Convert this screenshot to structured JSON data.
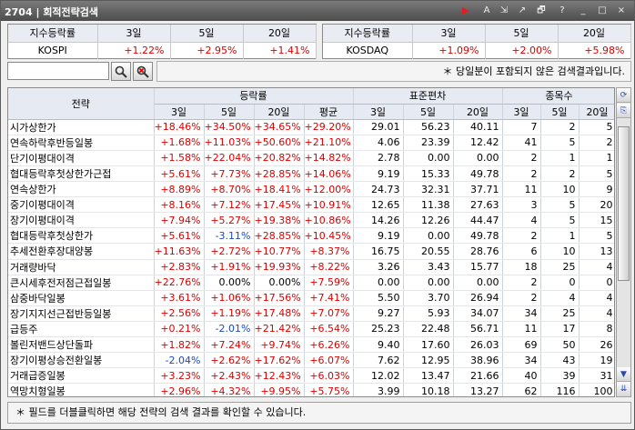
{
  "window": {
    "code": "2704",
    "title": "회적전략검색"
  },
  "title_controls": [
    "▶",
    "A",
    "⇲",
    "↗",
    "🗗",
    "?",
    "_",
    "□",
    "×"
  ],
  "index_boxes": [
    {
      "header": [
        "지수등락률",
        "3일",
        "5일",
        "20일"
      ],
      "values": [
        "KOSPI",
        "+1.22%",
        "+2.95%",
        "+1.41%"
      ]
    },
    {
      "header": [
        "지수등락률",
        "3일",
        "5일",
        "20일"
      ],
      "values": [
        "KOSDAQ",
        "+1.09%",
        "+2.00%",
        "+5.98%"
      ]
    }
  ],
  "search": {
    "value": "",
    "note": "＊ 당일분이 포함되지 않은 검색결과입니다."
  },
  "grid": {
    "col_strategy": "전략",
    "group_headers": [
      "등락률",
      "표준편차",
      "종목수"
    ],
    "sub_headers": [
      "3일",
      "5일",
      "20일",
      "평균",
      "3일",
      "5일",
      "20일",
      "3일",
      "5일",
      "20일"
    ],
    "rows": [
      [
        "시가상한가",
        "+18.46%",
        "+34.50%",
        "+34.65%",
        "+29.20%",
        "29.01",
        "56.23",
        "40.11",
        "7",
        "2",
        "5"
      ],
      [
        "연속하락후반등일봉",
        "+1.68%",
        "+11.03%",
        "+50.60%",
        "+21.10%",
        "4.06",
        "23.39",
        "12.42",
        "41",
        "5",
        "2"
      ],
      [
        "단기이평대이격",
        "+1.58%",
        "+22.04%",
        "+20.82%",
        "+14.82%",
        "2.78",
        "0.00",
        "0.00",
        "2",
        "1",
        "1"
      ],
      [
        "협대등락후첫상한가근접",
        "+5.61%",
        "+7.73%",
        "+28.85%",
        "+14.06%",
        "9.19",
        "15.33",
        "49.78",
        "2",
        "2",
        "5"
      ],
      [
        "연속상한가",
        "+8.89%",
        "+8.70%",
        "+18.41%",
        "+12.00%",
        "24.73",
        "32.31",
        "37.71",
        "11",
        "10",
        "9"
      ],
      [
        "중기이평대이격",
        "+8.16%",
        "+7.12%",
        "+17.45%",
        "+10.91%",
        "12.65",
        "11.38",
        "27.63",
        "3",
        "5",
        "20"
      ],
      [
        "장기이평대이격",
        "+7.94%",
        "+5.27%",
        "+19.38%",
        "+10.86%",
        "14.26",
        "12.26",
        "44.47",
        "4",
        "5",
        "15"
      ],
      [
        "협대등락후첫상한가",
        "+5.61%",
        "-3.11%",
        "+28.85%",
        "+10.45%",
        "9.19",
        "0.00",
        "49.78",
        "2",
        "1",
        "5"
      ],
      [
        "추세전환후장대양봉",
        "+11.63%",
        "+2.72%",
        "+10.77%",
        "+8.37%",
        "16.75",
        "20.55",
        "28.76",
        "6",
        "10",
        "13"
      ],
      [
        "거래량바닥",
        "+2.83%",
        "+1.91%",
        "+19.93%",
        "+8.22%",
        "3.26",
        "3.43",
        "15.77",
        "18",
        "25",
        "4"
      ],
      [
        "큰시세후전저점근접일봉",
        "+22.76%",
        "0.00%",
        "0.00%",
        "+7.59%",
        "0.00",
        "0.00",
        "0.00",
        "2",
        "0",
        "0"
      ],
      [
        "삼중바닥일봉",
        "+3.61%",
        "+1.06%",
        "+17.56%",
        "+7.41%",
        "5.50",
        "3.70",
        "26.94",
        "2",
        "4",
        "4"
      ],
      [
        "장기지지선근접반등일봉",
        "+2.56%",
        "+1.19%",
        "+17.48%",
        "+7.07%",
        "9.27",
        "5.93",
        "34.07",
        "34",
        "25",
        "4"
      ],
      [
        "급등주",
        "+0.21%",
        "-2.01%",
        "+21.42%",
        "+6.54%",
        "25.23",
        "22.48",
        "56.71",
        "11",
        "17",
        "8"
      ],
      [
        "볼린저밴드상단돌파",
        "+1.82%",
        "+7.24%",
        "+9.74%",
        "+6.26%",
        "9.40",
        "17.60",
        "26.03",
        "69",
        "50",
        "26"
      ],
      [
        "장기이평상승전환일봉",
        "-2.04%",
        "+2.62%",
        "+17.62%",
        "+6.07%",
        "7.62",
        "12.95",
        "38.96",
        "34",
        "43",
        "19"
      ],
      [
        "거래급증일봉",
        "+3.23%",
        "+2.43%",
        "+12.43%",
        "+6.03%",
        "12.02",
        "13.47",
        "21.66",
        "40",
        "39",
        "31"
      ],
      [
        "역망치형일봉",
        "+2.96%",
        "+4.32%",
        "+9.95%",
        "+5.75%",
        "3.99",
        "10.18",
        "13.27",
        "62",
        "116",
        "100"
      ]
    ]
  },
  "footer": "＊ 필드를 더블클릭하면 해당 전략의 검색 결과를 확인할 수 있습니다.",
  "colors": {
    "up": "#d00000",
    "down": "#1848c8",
    "header_bg": "#e6eaf2"
  }
}
